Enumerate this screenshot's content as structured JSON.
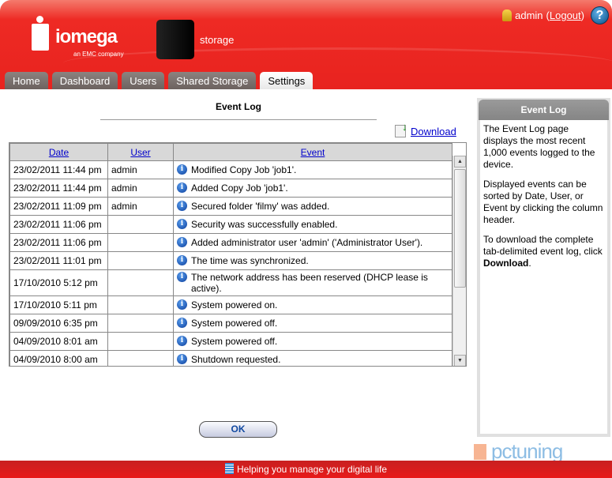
{
  "header": {
    "brand": "iomega",
    "brand_sub": "an EMC company",
    "device_name": "storage",
    "user": "admin",
    "logout_label": "Logout",
    "help_label": "?"
  },
  "tabs": [
    {
      "label": "Home"
    },
    {
      "label": "Dashboard"
    },
    {
      "label": "Users"
    },
    {
      "label": "Shared Storage"
    },
    {
      "label": "Settings",
      "active": true
    }
  ],
  "main": {
    "title": "Event Log",
    "download_label": "Download",
    "columns": {
      "date": "Date",
      "user": "User",
      "event": "Event"
    },
    "rows": [
      {
        "date": "23/02/2011 11:44 pm",
        "user": "admin",
        "event": "Modified Copy Job 'job1'."
      },
      {
        "date": "23/02/2011 11:44 pm",
        "user": "admin",
        "event": "Added Copy Job 'job1'."
      },
      {
        "date": "23/02/2011 11:09 pm",
        "user": "admin",
        "event": "Secured folder 'filmy' was added."
      },
      {
        "date": "23/02/2011 11:06 pm",
        "user": "",
        "event": "Security was successfully enabled."
      },
      {
        "date": "23/02/2011 11:06 pm",
        "user": "",
        "event": "Added administrator user 'admin' ('Administrator User')."
      },
      {
        "date": "23/02/2011 11:01 pm",
        "user": "",
        "event": "The time was synchronized."
      },
      {
        "date": "17/10/2010 5:12 pm",
        "user": "",
        "event": "The network address has been reserved (DHCP lease is active)."
      },
      {
        "date": "17/10/2010 5:11 pm",
        "user": "",
        "event": "System powered on."
      },
      {
        "date": "09/09/2010 6:35 pm",
        "user": "",
        "event": "System powered off."
      },
      {
        "date": "04/09/2010 8:01 am",
        "user": "",
        "event": "System powered off."
      },
      {
        "date": "04/09/2010 8:00 am",
        "user": "",
        "event": "Shutdown requested."
      }
    ],
    "ok_label": "OK"
  },
  "sidebar": {
    "title": "Event Log",
    "p1": "The Event Log page displays the most recent 1,000 events logged to the device.",
    "p2": "Displayed events can be sorted by Date, User, or Event by clicking the column header.",
    "p3_pre": "To download the complete tab-delimited event log, click ",
    "p3_bold": "Download",
    "p3_post": "."
  },
  "footer": {
    "tagline": "Helping you manage your digital life"
  },
  "watermark": "pctuning",
  "colors": {
    "brand_red": "#e8231f",
    "link": "#0000cc"
  }
}
